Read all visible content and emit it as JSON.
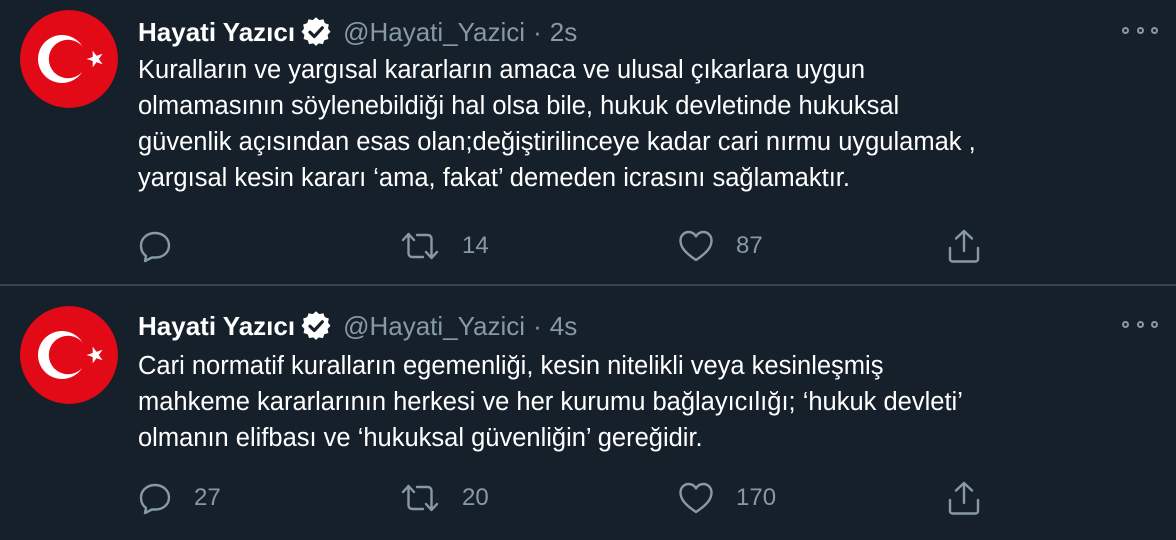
{
  "colors": {
    "background": "#15202b",
    "divider": "#38444d",
    "muted": "#8899a6",
    "text": "#ffffff",
    "flag_red": "#e30a17",
    "verified_fill": "#ffffff",
    "verified_check": "#15202b"
  },
  "tweets": [
    {
      "avatar_icon": "turkish-flag-icon",
      "name": "Hayati Yazıcı",
      "verified_icon": "verified-badge-icon",
      "handle": "@Hayati_Yazici",
      "separator": "·",
      "time": "2s",
      "more_icon": "more-options-icon",
      "lines": [
        "Kuralların ve yargısal kararların amaca ve ulusal çıkarlara uygun",
        "olmamasının söylenebildiği hal olsa bile, hukuk devletinde hukuksal",
        "güvenlik açısından esas olan;değiştirilinceye kadar cari nırmu uygulamak ,",
        "yargısal kesin kararı ‘ama, fakat’ demeden icrasını sağlamaktır."
      ],
      "reply_count": "",
      "retweet_count": "14",
      "like_count": "87"
    },
    {
      "avatar_icon": "turkish-flag-icon",
      "name": "Hayati Yazıcı",
      "verified_icon": "verified-badge-icon",
      "handle": "@Hayati_Yazici",
      "separator": "·",
      "time": "4s",
      "more_icon": "more-options-icon",
      "lines": [
        "Cari normatif kuralların egemenliği, kesin nitelikli veya kesinleşmiş",
        "mahkeme kararlarının herkesi ve her kurumu bağlayıcılığı; ‘hukuk devleti’",
        "olmanın elifbası ve ‘hukuksal güvenliğin’ gereğidir."
      ],
      "reply_count": "27",
      "retweet_count": "20",
      "like_count": "170"
    }
  ]
}
